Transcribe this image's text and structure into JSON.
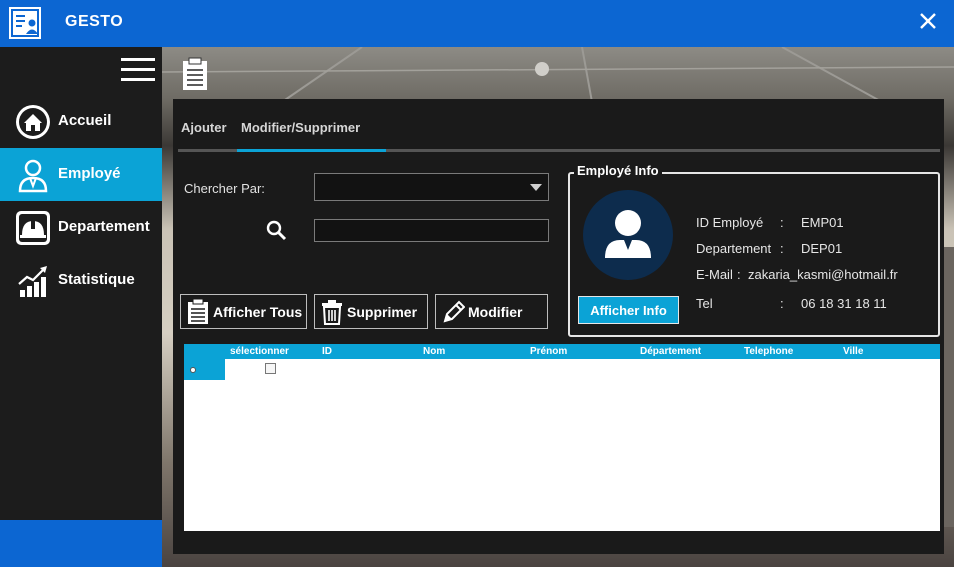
{
  "app": {
    "title": "GESTO"
  },
  "sidebar": {
    "items": [
      {
        "label": "Accueil",
        "icon": "home-icon",
        "active": false
      },
      {
        "label": "Employé",
        "icon": "user-icon",
        "active": true
      },
      {
        "label": "Departement",
        "icon": "hardhat-icon",
        "active": false
      },
      {
        "label": "Statistique",
        "icon": "chart-icon",
        "active": false
      }
    ]
  },
  "tabs": [
    {
      "label": "Ajouter",
      "active": false
    },
    {
      "label": "Modifier/Supprimer",
      "active": true
    }
  ],
  "search": {
    "label": "Chercher Par:",
    "select_value": "",
    "input_value": ""
  },
  "buttons": {
    "show_all": "Afficher Tous",
    "delete": "Supprimer",
    "edit": "Modifier",
    "show_info": "Afficher Info"
  },
  "employee_info": {
    "title": "Employé Info",
    "fields": [
      {
        "label": "ID Employé",
        "sep": ":",
        "value": "EMP01"
      },
      {
        "label": "Departement",
        "sep": ":",
        "value": "DEP01"
      },
      {
        "label": "E-Mail",
        "sep": ":",
        "value": "zakaria_kasmi@hotmail.fr"
      },
      {
        "label": "Tel",
        "sep": ":",
        "value": "06 18 31 18 11"
      }
    ]
  },
  "table": {
    "columns": [
      "sélectionner",
      "ID",
      "Nom",
      "Prénom",
      "Département",
      "Telephone",
      "Ville"
    ],
    "rows": [
      {
        "selected": false
      }
    ]
  },
  "colors": {
    "titlebar": "#0c66d2",
    "accent": "#0ba3d6",
    "sidebar": "#1c1c1c",
    "panel": "#1a1a1a"
  }
}
